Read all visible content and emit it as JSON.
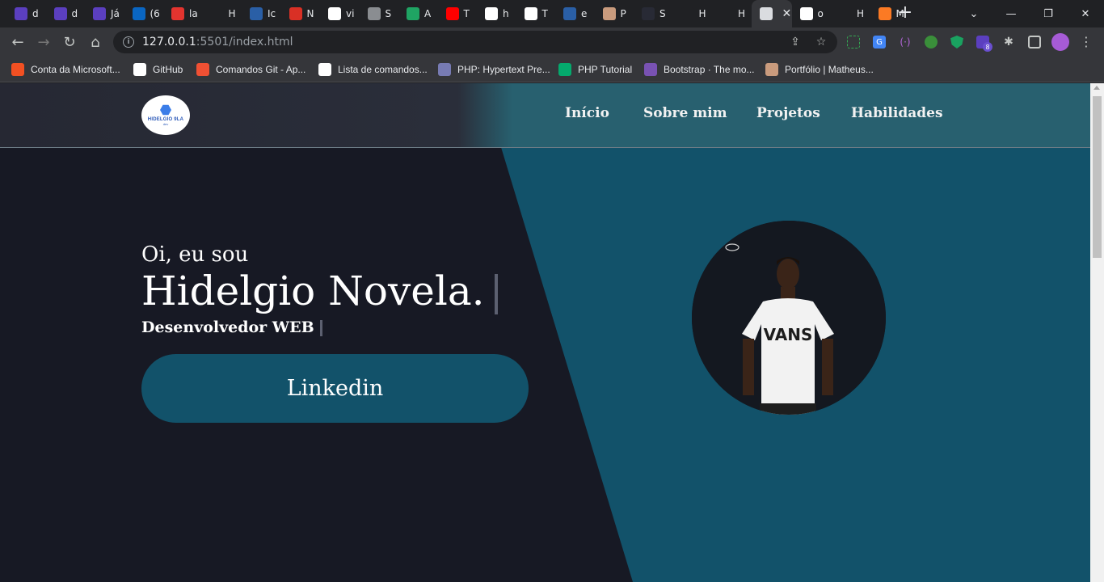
{
  "browser": {
    "tabs": [
      {
        "fav": "list-icon",
        "label": "d",
        "color": "#5b3fbf"
      },
      {
        "fav": "list-icon",
        "label": "d",
        "color": "#5b3fbf"
      },
      {
        "fav": "list-icon",
        "label": "Já",
        "color": "#5b3fbf"
      },
      {
        "fav": "linkedin-icon",
        "label": "(6",
        "color": "#0a66c2"
      },
      {
        "fav": "laravel-icon",
        "label": "la",
        "color": "#e3342f"
      },
      {
        "fav": "blank",
        "label": "H",
        "color": "#202124"
      },
      {
        "fav": "angular-icon",
        "label": "Ic",
        "color": "#2a5fa6"
      },
      {
        "fav": "gmail-icon",
        "label": "N",
        "color": "#d93025"
      },
      {
        "fav": "google-icon",
        "label": "vi",
        "color": "#ffffff"
      },
      {
        "fav": "globe-icon",
        "label": "S",
        "color": "#8a8d91"
      },
      {
        "fav": "drive-icon",
        "label": "A",
        "color": "#1fa463"
      },
      {
        "fav": "youtube-icon",
        "label": "T",
        "color": "#ff0000"
      },
      {
        "fav": "github-icon",
        "label": "h",
        "color": "#ffffff"
      },
      {
        "fav": "github-icon",
        "label": "T",
        "color": "#ffffff"
      },
      {
        "fav": "angular-icon",
        "label": "e",
        "color": "#2a5fa6"
      },
      {
        "fav": "avatar-icon",
        "label": "P",
        "color": "#c99b7d"
      },
      {
        "fav": "w3-icon",
        "label": "S",
        "color": "#282a35"
      },
      {
        "fav": "blank",
        "label": "H",
        "color": "#202124"
      },
      {
        "fav": "blank",
        "label": "H",
        "color": "#202124"
      },
      {
        "fav": "grid-icon",
        "label": "",
        "color": "#dadce0",
        "active": true
      },
      {
        "fav": "google-icon",
        "label": "o",
        "color": "#ffffff"
      },
      {
        "fav": "blank",
        "label": "H",
        "color": "#202124"
      },
      {
        "fav": "xampp-icon",
        "label": "M",
        "color": "#fb7a24"
      }
    ],
    "url_host": "127.0.0.1",
    "url_path": ":5501/index.html",
    "bookmarks": [
      {
        "label": "Conta da Microsoft...",
        "icon": "microsoft-icon",
        "color": "#f25022"
      },
      {
        "label": "GitHub",
        "icon": "github-icon",
        "color": "#ffffff"
      },
      {
        "label": "Comandos Git - Ap...",
        "icon": "git-icon",
        "color": "#f05033"
      },
      {
        "label": "Lista de comandos...",
        "icon": "github-icon",
        "color": "#ffffff"
      },
      {
        "label": "PHP: Hypertext Pre...",
        "icon": "php-icon",
        "color": "#777bb3"
      },
      {
        "label": "PHP Tutorial",
        "icon": "w-icon",
        "color": "#04aa6d"
      },
      {
        "label": "Bootstrap · The mo...",
        "icon": "bootstrap-icon",
        "color": "#7952b3"
      },
      {
        "label": "Portfólio | Matheus...",
        "icon": "avatar-icon",
        "color": "#c99b7d"
      }
    ],
    "extension_badge": "8"
  },
  "site": {
    "logo_text": "HIDELGIO 9LA",
    "logo_sub": "dev",
    "nav": [
      "Início",
      "Sobre mim",
      "Projetos",
      "Habilidades"
    ],
    "hero": {
      "greeting": "Oi, eu sou",
      "name": "Hidelgio Novela.",
      "role": "Desenvolvedor WEB",
      "cta": "Linkedin"
    },
    "colors": {
      "dark_panel": "#171924",
      "teal_panel": "#12526a",
      "header_teal": "#28606f"
    }
  }
}
